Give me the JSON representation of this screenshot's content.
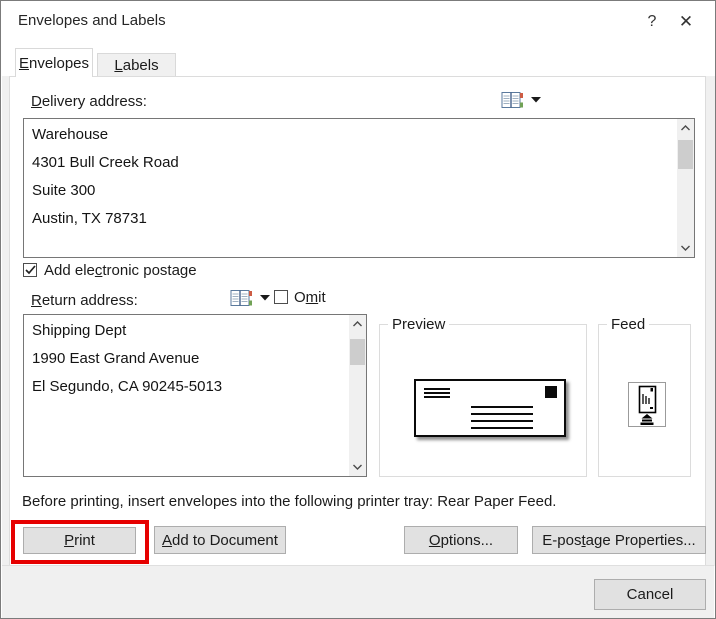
{
  "dialog": {
    "title": "Envelopes and Labels",
    "help_glyph": "?",
    "close_glyph": "✕"
  },
  "tabs": {
    "envelopes": {
      "pre": "",
      "accel": "E",
      "post": "nvelopes",
      "active": true
    },
    "labels": {
      "pre": "",
      "accel": "L",
      "post": "abels",
      "active": false
    }
  },
  "delivery": {
    "label": {
      "pre": "",
      "accel": "D",
      "post": "elivery address:"
    },
    "lines": [
      "Warehouse",
      "4301 Bull Creek Road",
      "Suite 300",
      "Austin, TX 78731"
    ]
  },
  "postage": {
    "label": {
      "pre": "Add ele",
      "accel": "c",
      "post": "tronic postage"
    },
    "checked": true
  },
  "return": {
    "label": {
      "pre": "",
      "accel": "R",
      "post": "eturn address:"
    },
    "lines": [
      "Shipping Dept",
      "1990 East Grand Avenue",
      "El Segundo, CA 90245-5013"
    ]
  },
  "omit": {
    "label": {
      "pre": "O",
      "accel": "m",
      "post": "it"
    },
    "checked": false
  },
  "preview": {
    "label": "Preview"
  },
  "feed": {
    "label": "Feed"
  },
  "tray_note": "Before printing, insert envelopes into the following printer tray: Rear Paper Feed.",
  "buttons": {
    "print": {
      "pre": "",
      "accel": "P",
      "post": "rint"
    },
    "add_to_document": {
      "pre": "",
      "accel": "A",
      "post": "dd to Document"
    },
    "options": {
      "pre": "",
      "accel": "O",
      "post": "ptions..."
    },
    "epostage": {
      "pre": "E-pos",
      "accel": "t",
      "post": "age Properties..."
    },
    "cancel": {
      "pre": "Cancel",
      "accel": "",
      "post": ""
    }
  },
  "icons": {
    "address_book": "address-book-icon",
    "dropdown": "chevron-down-icon",
    "scroll_up": "chevron-up-icon",
    "scroll_down": "chevron-down-icon",
    "checkmark": "check-icon"
  },
  "colors": {
    "annotation_red": "#e60000",
    "button_bg": "#e1e1e1",
    "button_border": "#adadad",
    "dialog_chrome": "#f0f0f0",
    "scroll_thumb": "#cdcdcd",
    "book_tab_red": "#cd5c44",
    "book_tab_green": "#71a256"
  }
}
